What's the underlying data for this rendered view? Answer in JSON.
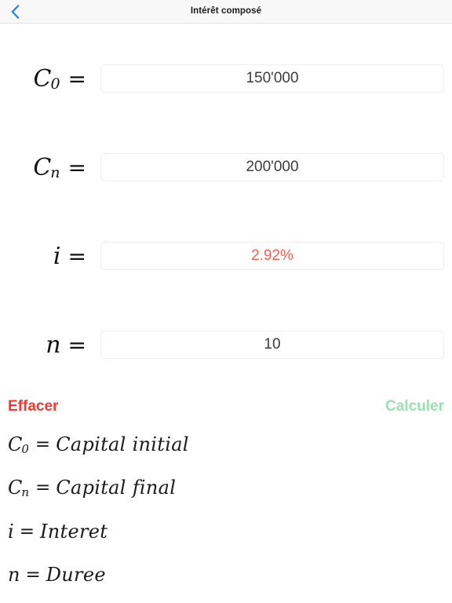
{
  "header": {
    "title": "Intérêt composé",
    "back_icon": "chevron-left-icon",
    "back_color": "#1a7cf0",
    "background": "#f8f8f8"
  },
  "fields": [
    {
      "symbol": "C",
      "subscript": "0",
      "equals": "=",
      "value": "150'000",
      "placeholder": "",
      "color": "#3c3c3c"
    },
    {
      "symbol": "C",
      "subscript": "n",
      "equals": "=",
      "value": "200'000",
      "placeholder": "",
      "color": "#3c3c3c"
    },
    {
      "symbol": "i",
      "subscript": "",
      "equals": "=",
      "value": "2.92%",
      "placeholder": "",
      "color": "#f75f55"
    },
    {
      "symbol": "n",
      "subscript": "",
      "equals": "=",
      "value": "10",
      "placeholder": "",
      "color": "#3c3c3c"
    }
  ],
  "actions": {
    "clear_label": "Effacer",
    "clear_color": "#f8382f",
    "calculate_label": "Calculer",
    "calculate_color": "#9ce0b2"
  },
  "legend": [
    {
      "symbol": "C",
      "subscript": "0",
      "equals": "=",
      "description": "Capital initial"
    },
    {
      "symbol": "C",
      "subscript": "n",
      "equals": "=",
      "description": "Capital final"
    },
    {
      "symbol": "i",
      "subscript": "",
      "equals": "=",
      "description": "Interet"
    },
    {
      "symbol": "n",
      "subscript": "",
      "equals": "=",
      "description": "Duree"
    }
  ]
}
